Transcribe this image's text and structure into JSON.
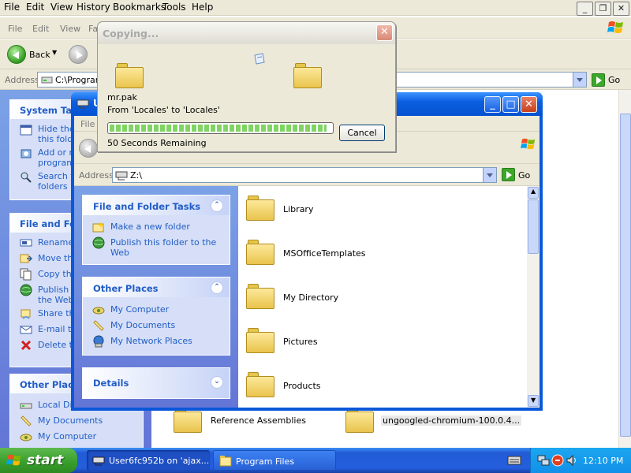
{
  "background_window": {
    "menu": [
      "File",
      "Edit",
      "View",
      "History",
      "Bookmarks",
      "Tools",
      "Help"
    ],
    "menu2": [
      "File",
      "Edit",
      "View",
      "Fa"
    ],
    "back_label": "Back",
    "address_label": "Address",
    "address_value": "C:\\Program",
    "go_label": "Go",
    "system_tasks": {
      "title": "System Tas",
      "items": [
        "Hide the\nthis folde",
        "Add or r\nprogram",
        "Search f\nfolders"
      ]
    },
    "file_folder_tasks": {
      "title": "File and Fol",
      "items": [
        "Rename",
        "Move th",
        "Copy th",
        "Publish t\nthe Web",
        "Share th",
        "E-mail th",
        "Delete th"
      ]
    },
    "other_places": {
      "title": "Other Place",
      "items": [
        "Local Dis",
        "My Documents",
        "My Computer"
      ]
    },
    "folders": [
      "Reference Assemblies",
      "ungoogled-chromium-100.0.4..."
    ]
  },
  "z_window": {
    "title": "U",
    "menu": "File",
    "address_label": "Address",
    "address_value": "Z:\\",
    "go_label": "Go",
    "file_folder_tasks": {
      "title": "File and Folder Tasks",
      "items": [
        "Make a new folder",
        "Publish this folder to the\nWeb"
      ]
    },
    "other_places": {
      "title": "Other Places",
      "items": [
        "My Computer",
        "My Documents",
        "My Network Places"
      ]
    },
    "details": {
      "title": "Details"
    },
    "folders": [
      "Library",
      "MSOfficeTemplates",
      "My Directory",
      "Pictures",
      "Products"
    ]
  },
  "copy_dialog": {
    "title": "Copying...",
    "filename": "mr.pak",
    "from_to": "From 'Locales' to 'Locales'",
    "progress": 0.98,
    "remaining": "50 Seconds Remaining",
    "cancel_label": "Cancel"
  },
  "taskbar": {
    "start_label": "start",
    "tasks": [
      "User6fc952b on 'ajax...",
      "Program Files"
    ],
    "clock": "12:10 PM"
  }
}
